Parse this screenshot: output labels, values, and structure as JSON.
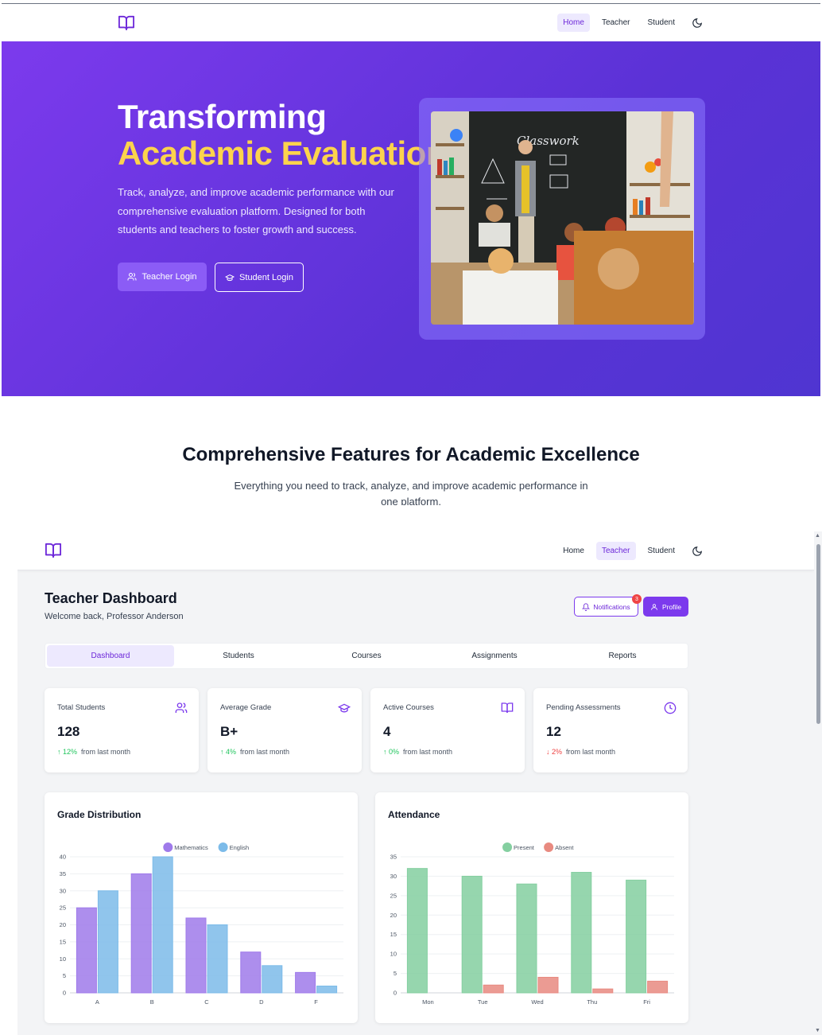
{
  "topnav": {
    "links": [
      {
        "label": "Home",
        "active": true
      },
      {
        "label": "Teacher",
        "active": false
      },
      {
        "label": "Student",
        "active": false
      }
    ]
  },
  "hero": {
    "title_line1": "Transforming",
    "title_line2": "Academic Evaluation",
    "description": "Track, analyze, and improve academic performance with our comprehensive evaluation platform. Designed for both students and teachers to foster growth and success.",
    "teacher_login_label": "Teacher Login",
    "student_login_label": "Student Login",
    "chalkboard_text": "Classwork",
    "colors": {
      "accent": "#fcd34d",
      "gradient_start": "#7c3aed",
      "gradient_end": "#4f35d1"
    }
  },
  "features": {
    "title": "Comprehensive Features for Academic Excellence",
    "subtitle": "Everything you need to track, analyze, and improve academic performance in one platform."
  },
  "app": {
    "nav": {
      "links": [
        {
          "label": "Home",
          "active": false
        },
        {
          "label": "Teacher",
          "active": true
        },
        {
          "label": "Student",
          "active": false
        }
      ]
    },
    "dashboard": {
      "title": "Teacher Dashboard",
      "welcome": "Welcome back, Professor Anderson",
      "notifications_label": "Notifications",
      "notifications_count": "3",
      "profile_label": "Profile"
    },
    "tabs": [
      {
        "label": "Dashboard",
        "active": true
      },
      {
        "label": "Students",
        "active": false
      },
      {
        "label": "Courses",
        "active": false
      },
      {
        "label": "Assignments",
        "active": false
      },
      {
        "label": "Reports",
        "active": false
      }
    ],
    "stats": [
      {
        "label": "Total Students",
        "value": "128",
        "trend": "12%",
        "direction": "up",
        "suffix": "from last month",
        "icon": "users-icon"
      },
      {
        "label": "Average Grade",
        "value": "B+",
        "trend": "4%",
        "direction": "up",
        "suffix": "from last month",
        "icon": "graduation-cap-icon"
      },
      {
        "label": "Active Courses",
        "value": "4",
        "trend": "0%",
        "direction": "up",
        "suffix": "from last month",
        "icon": "book-open-icon"
      },
      {
        "label": "Pending Assessments",
        "value": "12",
        "trend": "2%",
        "direction": "down",
        "suffix": "from last month",
        "icon": "clock-icon"
      }
    ]
  },
  "chart_data": [
    {
      "type": "bar",
      "title": "Grade Distribution",
      "categories": [
        "A",
        "B",
        "C",
        "D",
        "F"
      ],
      "series": [
        {
          "name": "Mathematics",
          "values": [
            25,
            35,
            22,
            12,
            6
          ],
          "color": "#9f7aea"
        },
        {
          "name": "English",
          "values": [
            30,
            40,
            20,
            8,
            2
          ],
          "color": "#7cbbe9"
        }
      ],
      "ylim": [
        0,
        40
      ],
      "yticks": [
        0,
        5,
        10,
        15,
        20,
        25,
        30,
        35,
        40
      ],
      "legend": "top-center",
      "grid": true
    },
    {
      "type": "bar",
      "title": "Attendance",
      "categories": [
        "Mon",
        "Tue",
        "Wed",
        "Thu",
        "Fri"
      ],
      "series": [
        {
          "name": "Present",
          "values": [
            32,
            30,
            28,
            31,
            29
          ],
          "color": "#84cfa0"
        },
        {
          "name": "Absent",
          "values": [
            0,
            2,
            4,
            1,
            3
          ],
          "color": "#e88a80"
        }
      ],
      "ylim": [
        0,
        35
      ],
      "yticks": [
        0,
        5,
        10,
        15,
        20,
        25,
        30,
        35
      ],
      "legend": "top-center",
      "grid": true
    }
  ]
}
